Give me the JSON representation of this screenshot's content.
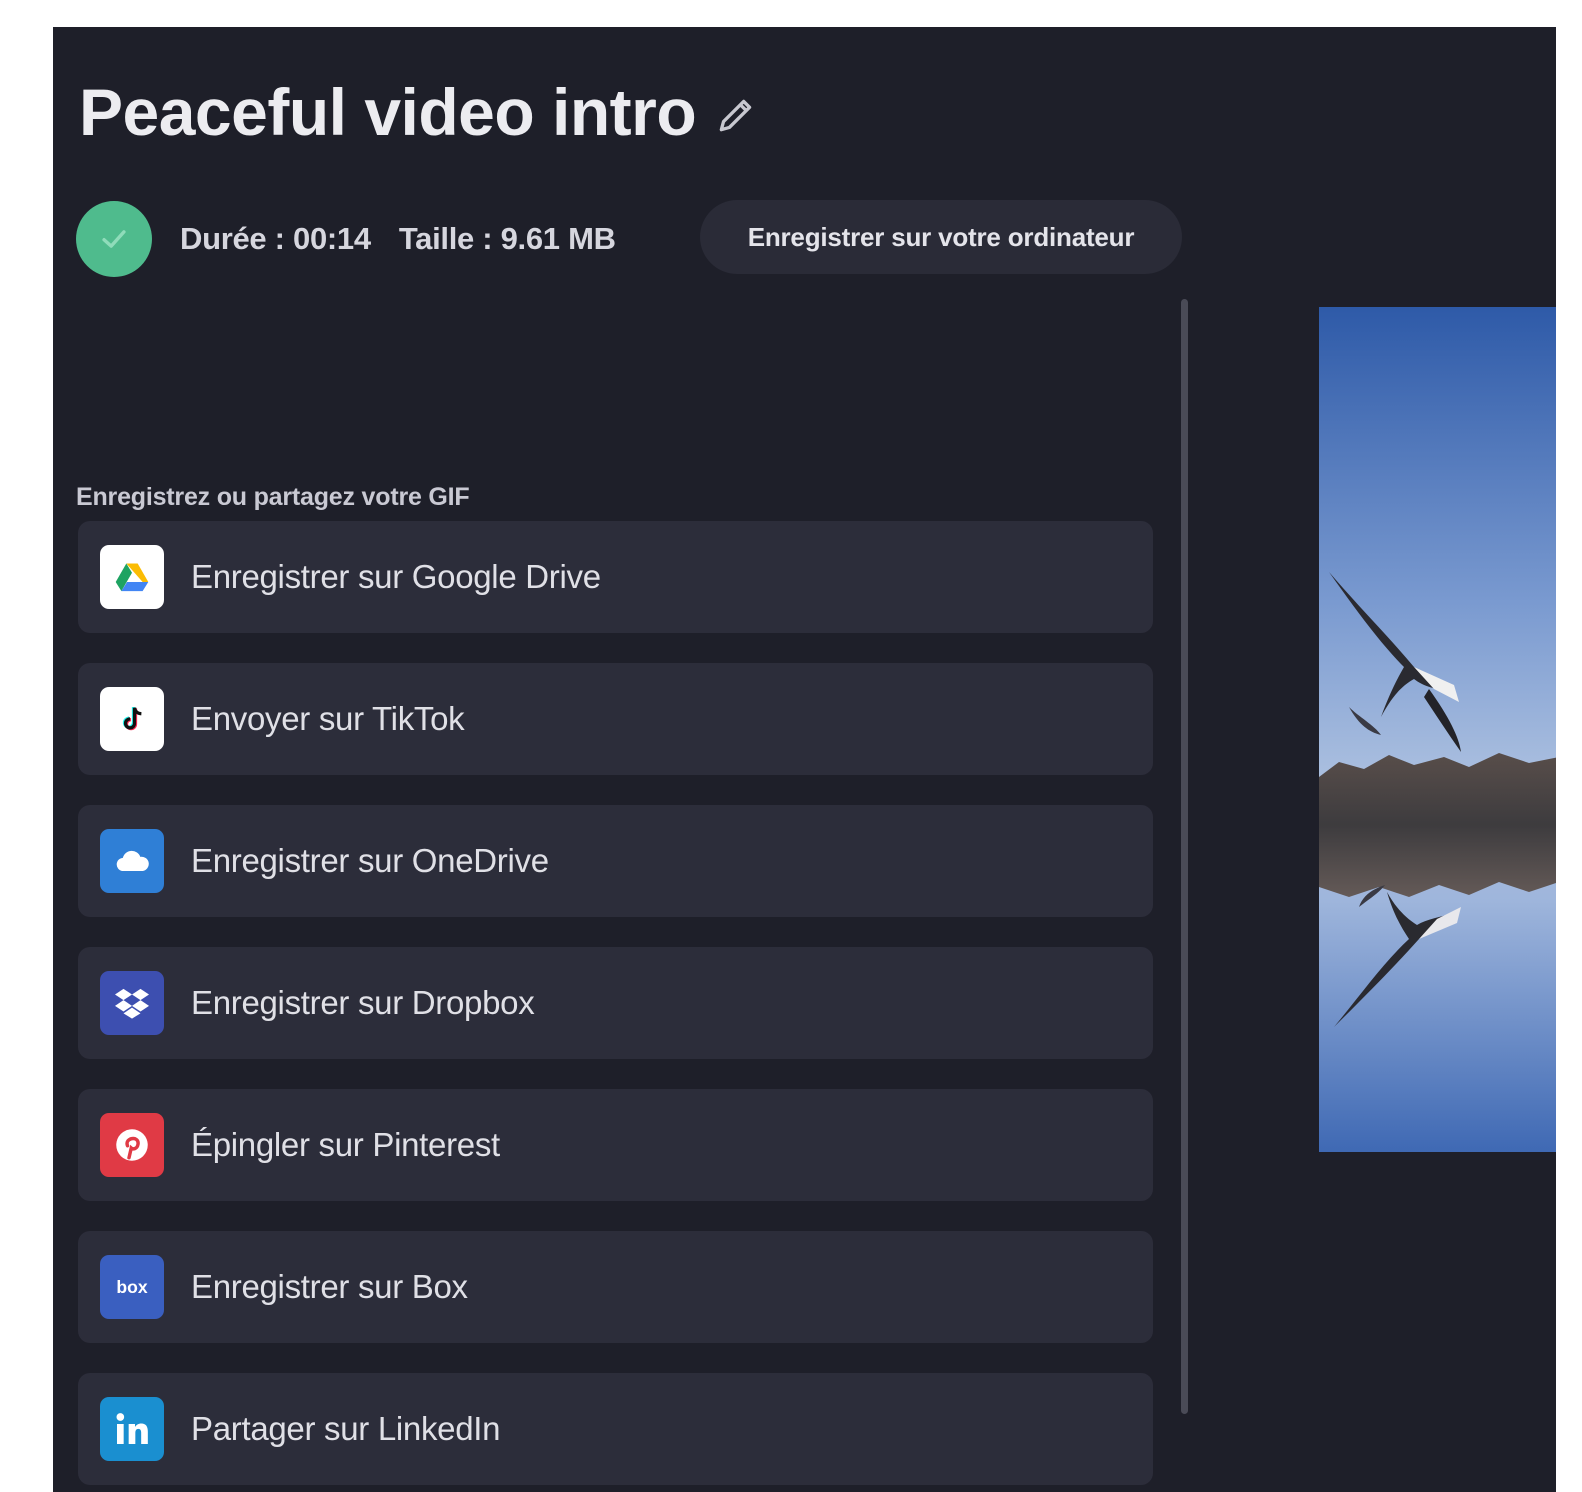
{
  "header": {
    "title": "Peaceful video intro"
  },
  "status": {
    "duration": "Durée : 00:14",
    "size": "Taille : 9.61 MB",
    "save_computer_label": "Enregistrer sur votre ordinateur"
  },
  "share": {
    "heading": "Enregistrez ou partagez votre GIF",
    "items": [
      {
        "label": "Enregistrer sur Google Drive",
        "icon": "google-drive-icon",
        "icon_bg": "#ffffff"
      },
      {
        "label": "Envoyer sur TikTok",
        "icon": "tiktok-icon",
        "icon_bg": "#ffffff"
      },
      {
        "label": "Enregistrer sur OneDrive",
        "icon": "onedrive-icon",
        "icon_bg": "#2f7fd6"
      },
      {
        "label": "Enregistrer sur Dropbox",
        "icon": "dropbox-icon",
        "icon_bg": "#3d4fb0"
      },
      {
        "label": "Épingler sur Pinterest",
        "icon": "pinterest-icon",
        "icon_bg": "#e03a45"
      },
      {
        "label": "Enregistrer sur Box",
        "icon": "box-icon",
        "icon_bg": "#3a5fc0"
      },
      {
        "label": "Partager sur LinkedIn",
        "icon": "linkedin-icon",
        "icon_bg": "#1a8fd0"
      }
    ]
  },
  "colors": {
    "panel_bg": "#1e1f29",
    "item_bg": "#2c2d3a",
    "success_green": "#4fbb8d"
  }
}
